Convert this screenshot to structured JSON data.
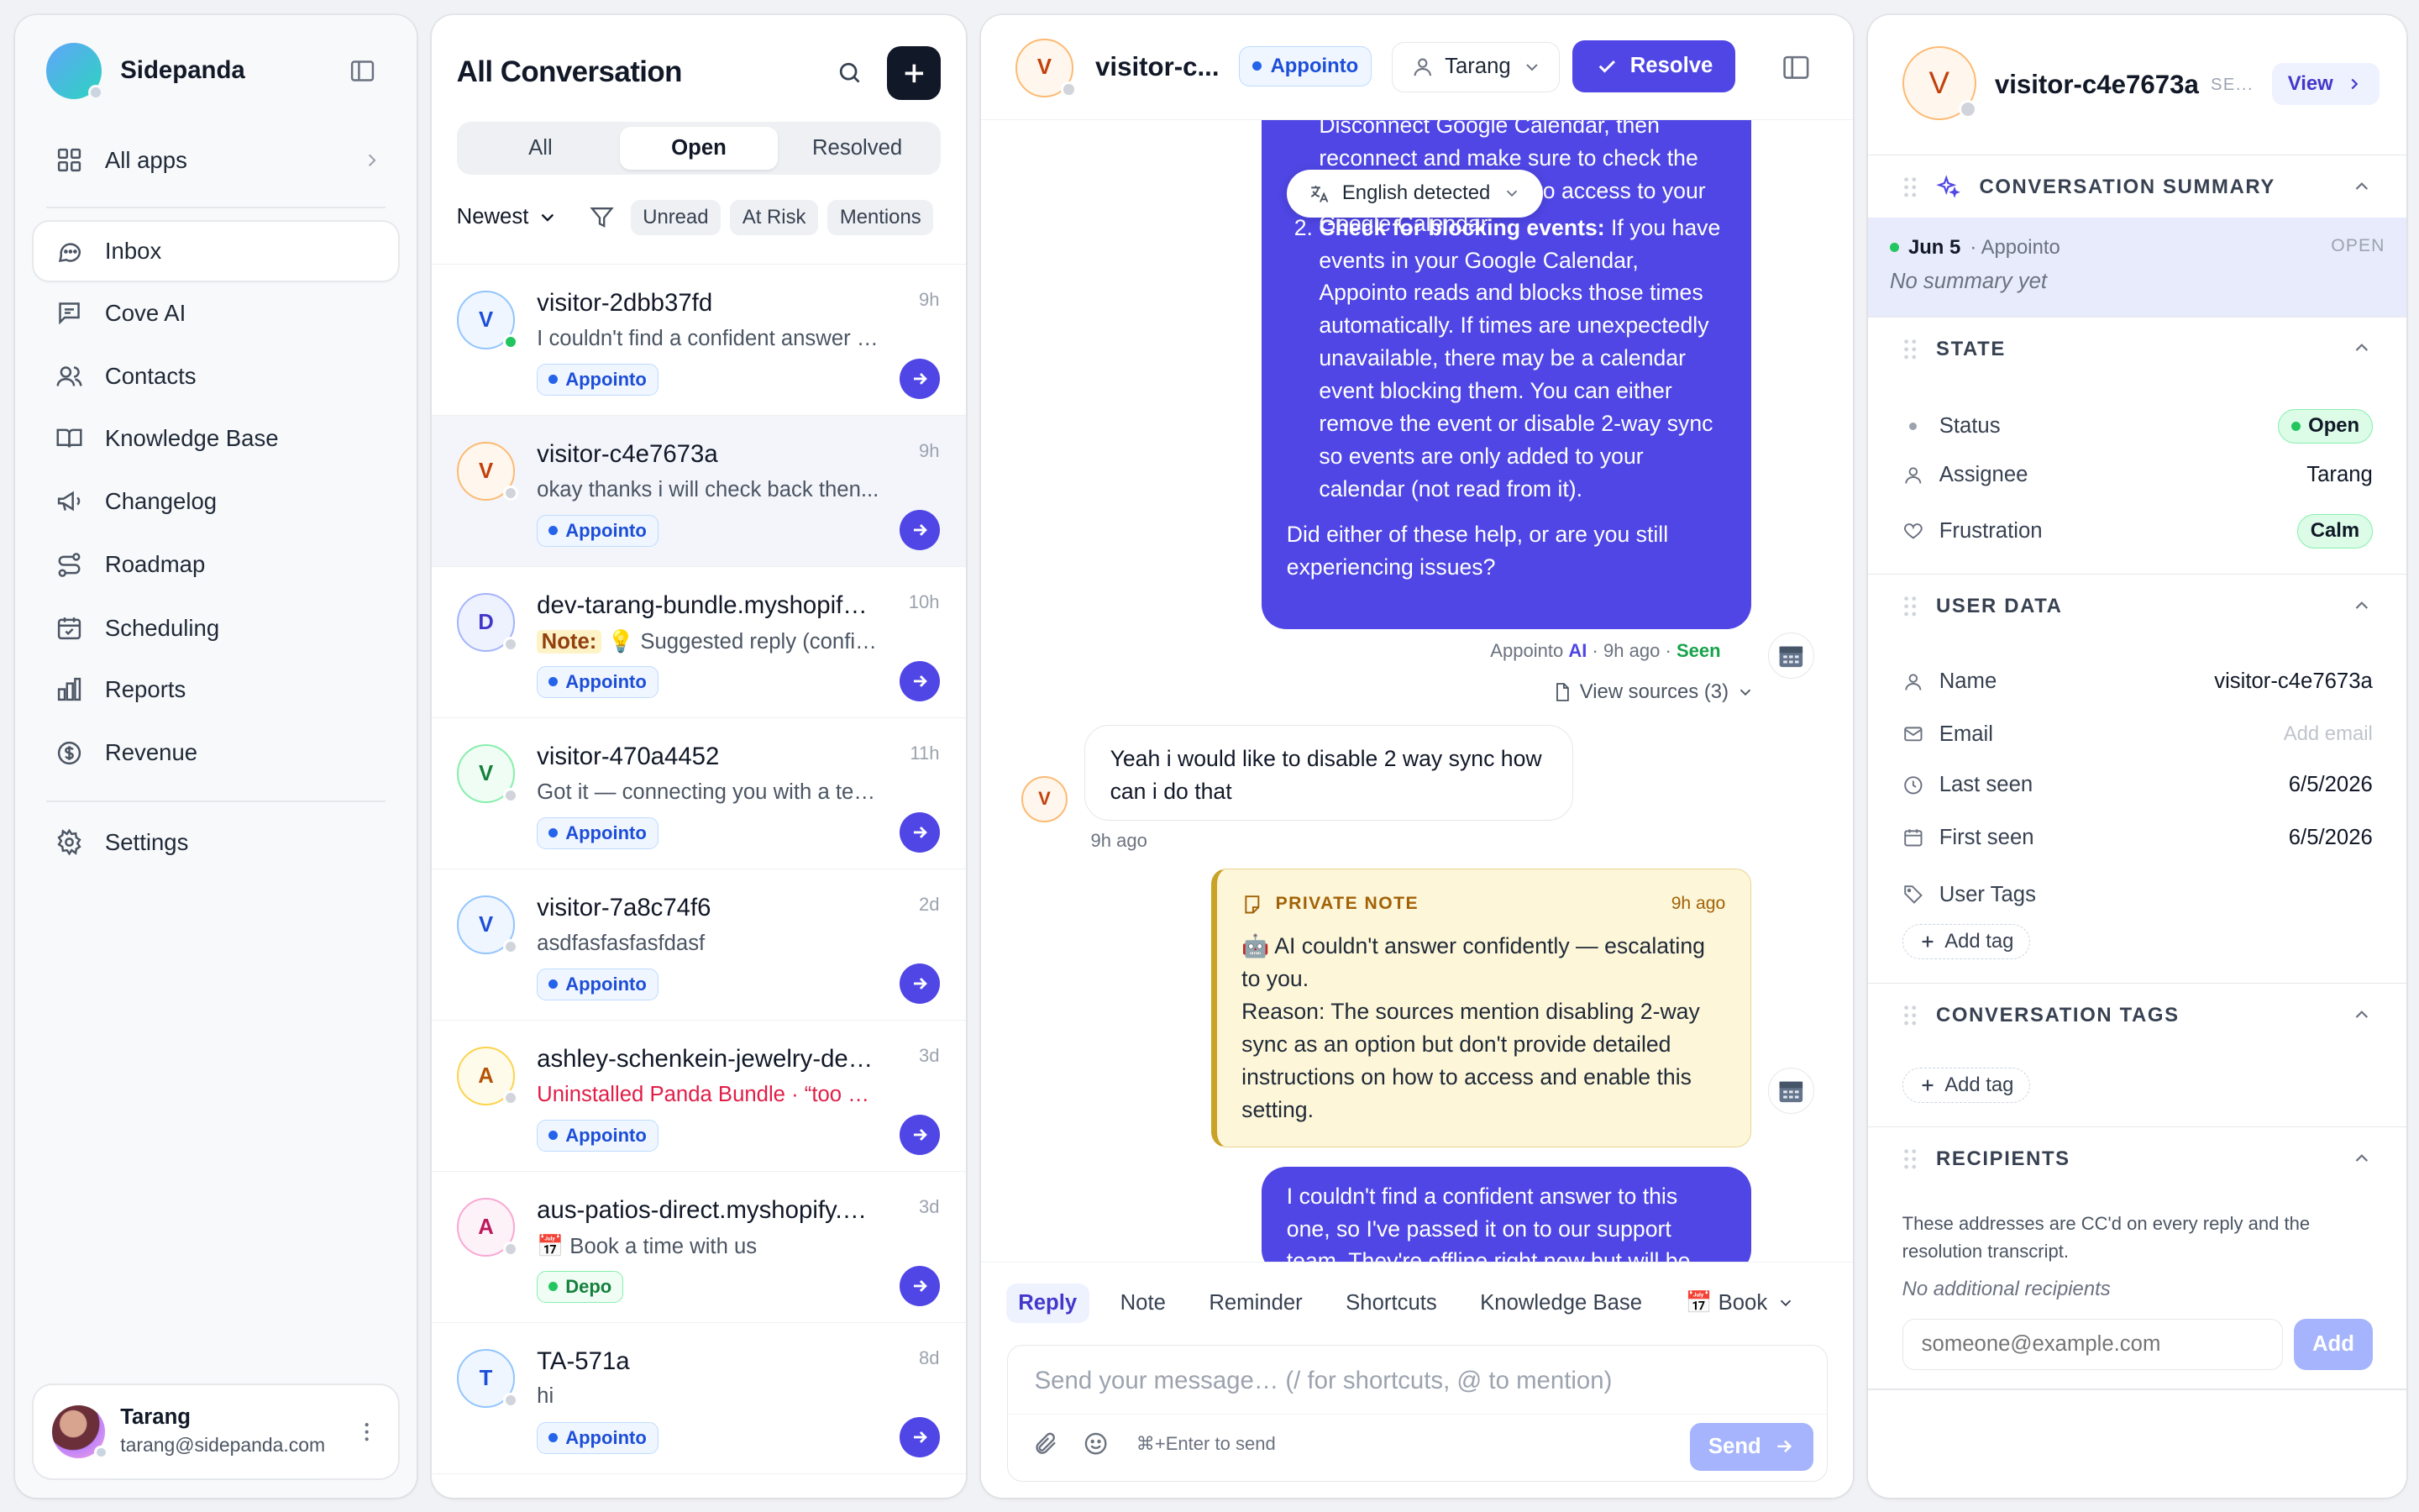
{
  "sidebar": {
    "brand": "Sidepanda",
    "all_apps": "All apps",
    "items": [
      {
        "label": "Inbox",
        "icon": "chat-bubble-icon",
        "active": true
      },
      {
        "label": "Cove AI",
        "icon": "message-square-icon"
      },
      {
        "label": "Contacts",
        "icon": "users-icon"
      },
      {
        "label": "Knowledge Base",
        "icon": "book-icon"
      },
      {
        "label": "Changelog",
        "icon": "megaphone-icon"
      },
      {
        "label": "Roadmap",
        "icon": "route-icon"
      },
      {
        "label": "Scheduling",
        "icon": "calendar-check-icon"
      },
      {
        "label": "Reports",
        "icon": "bar-chart-icon"
      },
      {
        "label": "Revenue",
        "icon": "dollar-circle-icon"
      }
    ],
    "settings": "Settings",
    "user": {
      "name": "Tarang",
      "email": "tarang@sidepanda.com"
    }
  },
  "conversation_list": {
    "title": "All Conversation",
    "tabs": [
      "All",
      "Open",
      "Resolved"
    ],
    "active_tab": "Open",
    "sort": "Newest",
    "chips": [
      "Unread",
      "At Risk",
      "Mentions"
    ],
    "rows": [
      {
        "initial": "V",
        "name": "visitor-2dbb37fd",
        "time": "9h",
        "preview": "I couldn't find a confident answer to this one, so I've passed it on",
        "tag": "Appointo",
        "online": true
      },
      {
        "initial": "V",
        "name": "visitor-c4e7673a",
        "time": "9h",
        "preview": "okay thanks i will check back then...",
        "tag": "Appointo",
        "selected": true
      },
      {
        "initial": "D",
        "name": "dev-tarang-bundle.myshopify.com",
        "time": "10h",
        "note_label": "Note:",
        "preview": "💡 Suggested reply (confidence: low)",
        "tag": "Appointo"
      },
      {
        "initial": "V",
        "name": "visitor-470a4452",
        "time": "11h",
        "preview": "Got it — connecting you with a teammate now.",
        "tag": "Appointo"
      },
      {
        "initial": "V",
        "name": "visitor-7a8c74f6",
        "time": "2d",
        "preview": "asdfasfasfasfdasf",
        "tag": "Appointo"
      },
      {
        "initial": "A",
        "name": "ashley-schenkein-jewelry-designs",
        "time": "3d",
        "preview": "Uninstalled Panda Bundle · “too expensive”",
        "tag": "Appointo",
        "alert": true
      },
      {
        "initial": "A",
        "name": "aus-patios-direct.myshopify.com",
        "time": "3d",
        "preview": "📅 Book a time with us",
        "tag": "Depo"
      },
      {
        "initial": "T",
        "name": "TA-571a",
        "time": "8d",
        "preview": "hi",
        "tag": "Appointo"
      }
    ]
  },
  "chat": {
    "visitor_initial": "V",
    "title": "visitor-c...",
    "app_tag": "Appointo",
    "assignee": "Tarang",
    "resolve_label": "Resolve",
    "language_badge": "English detected",
    "ai_top_lines": [
      "Disconnect Google Calendar, then",
      "reconnect and make sure to check the",
      "box to allow Appointo to access to your",
      "Google Calendar."
    ],
    "ai_item2_title": "Check for blocking events:",
    "ai_item2_body": " If you have events in your Google Calendar, Appointo reads and blocks those times automatically. If times are unexpectedly unavailable, there may be a calendar event blocking them. You can either remove the event or disable 2-way sync so events are only added to your calendar (not read from it).",
    "ai_question": "Did either of these help, or are you still experiencing issues?",
    "ai_meta_sender": "Appointo",
    "ai_meta_ai": "AI",
    "ai_meta_time": "· 9h ago ·",
    "ai_meta_status": "Seen",
    "view_sources": "View sources (3)",
    "user_message": "Yeah i would like to disable 2 way sync how can i do that",
    "user_time": "9h ago",
    "note_label": "PRIVATE NOTE",
    "note_time": "9h ago",
    "note_line1": "🤖 AI couldn't answer confidently — escalating to you.",
    "note_line2": "Reason: The sources mention disabling 2-way sync as an option but don't provide detailed instructions on how to access and enable this setting.",
    "ai_last": "I couldn't find a confident answer to this one, so I've passed it on to our support team. They're offline right now but will be",
    "composer": {
      "tabs": [
        "Reply",
        "Note",
        "Reminder",
        "Shortcuts",
        "Knowledge Base"
      ],
      "book_label": "📅 Book",
      "placeholder": "Send your message… (/ for shortcuts, @ to mention)",
      "hint": "⌘+Enter to send",
      "send_label": "Send"
    }
  },
  "details": {
    "initial": "V",
    "name": "visitor-c4e7673a",
    "sub": "SE...",
    "view_label": "View",
    "sections": {
      "summary": "CONVERSATION SUMMARY",
      "state": "STATE",
      "user_data": "USER DATA",
      "tags": "CONVERSATION TAGS",
      "recipients": "RECIPIENTS"
    },
    "summary_date": "Jun 5",
    "summary_app": "· Appointo",
    "summary_status": "OPEN",
    "summary_text": "No summary yet",
    "state": {
      "status_label": "Status",
      "status_value": "Open",
      "assignee_label": "Assignee",
      "assignee_value": "Tarang",
      "frustration_label": "Frustration",
      "frustration_value": "Calm"
    },
    "user": {
      "name_label": "Name",
      "name_value": "visitor-c4e7673a",
      "email_label": "Email",
      "email_value": "Add email",
      "last_seen_label": "Last seen",
      "last_seen_value": "6/5/2026",
      "first_seen_label": "First seen",
      "first_seen_value": "6/5/2026",
      "tags_label": "User Tags"
    },
    "add_tag": "Add tag",
    "recipients_text": "These addresses are CC'd on every reply and the resolution transcript.",
    "no_recipients": "No additional recipients",
    "email_placeholder": "someone@example.com",
    "add_label": "Add"
  },
  "colors": {
    "accent": "#4f46e5",
    "success": "#22c55e",
    "alert": "#e11d48",
    "note_bg": "#fdf6d8"
  }
}
